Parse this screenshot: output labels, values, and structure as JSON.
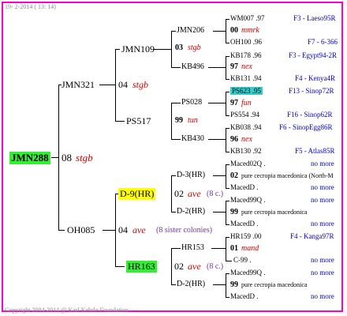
{
  "header": {
    "date": "19-  2-2014 ( 13: 14)"
  },
  "footer": {
    "copyright": "Copyright 2004-2014 @ Karl Kehrle Foundation ."
  },
  "root": {
    "name": "JMN288",
    "gen": "08",
    "breed": "stgb"
  },
  "g1": {
    "top": {
      "name": "JMN321"
    },
    "bot": {
      "name": "OH085",
      "gen": "04",
      "breed": "ave",
      "note": "(8 sister colonies)"
    }
  },
  "g2": {
    "a": {
      "name": "JMN109"
    },
    "mid": {
      "gen": "04",
      "breed": "stgb"
    },
    "b": {
      "name": "PS517"
    },
    "c": {
      "name": "D-9(HR)",
      "gen": "02",
      "breed": "ave",
      "note": "(8 c.)"
    },
    "d": {
      "name": "HR163",
      "gen": "02",
      "breed": "ave",
      "note": "(8 c.)"
    }
  },
  "g3": {
    "a": {
      "name": "JMN206",
      "gen": "03",
      "breed": "stgb"
    },
    "b": {
      "name": "KB496"
    },
    "c": {
      "name": "PS028",
      "gen": "99",
      "breed": "tun"
    },
    "d": {
      "name": "KB430"
    },
    "e": {
      "name": "D-3(HR)"
    },
    "f": {
      "name": "D-2(HR)"
    },
    "g": {
      "name": "HR153"
    },
    "h": {
      "name": "D-2(HR)"
    }
  },
  "g4": [
    {
      "name": "WM007 .97",
      "loc": "F3 - Laeso95R"
    },
    {
      "name": "00",
      "breed": "mmrk"
    },
    {
      "name": "OH100 .96",
      "loc": "F7 - 6-366"
    },
    {
      "name": "KB178 .96",
      "loc": "F3 - Egypt94-2R"
    },
    {
      "name": "97",
      "breed": "nex"
    },
    {
      "name": "KB131 .94",
      "loc": "F4 - Kenya4R"
    },
    {
      "name": "PS623 .95",
      "loc": "F13 - Sinop72R"
    },
    {
      "name": "97",
      "breed": "fun"
    },
    {
      "name": "PS554 .94",
      "loc": "F16 - Sinop62R"
    },
    {
      "name": "KB038 .94",
      "loc": "F6 - SinopEgg86R"
    },
    {
      "name": "96",
      "breed": "nex"
    },
    {
      "name": "KB130 .92",
      "loc": "F5 - Atlas85R"
    },
    {
      "name": "Maced02Q .",
      "loc": "no more"
    },
    {
      "name": "02",
      "breed": "pure cecropia macedonica (North-M"
    },
    {
      "name": "MacedD .",
      "loc": "no more"
    },
    {
      "name": "Maced99Q .",
      "loc": "no more"
    },
    {
      "name": "99",
      "breed": "pure cecropia macedonica"
    },
    {
      "name": "MacedD .",
      "loc": "no more"
    },
    {
      "name": "HR159 .00",
      "loc": "F4 - Kanga97R"
    },
    {
      "name": "01",
      "breed": "mand"
    },
    {
      "name": "C-99 .",
      "loc": "no more"
    },
    {
      "name": "Maced99Q .",
      "loc": "no more"
    },
    {
      "name": "99",
      "breed": "pure cecropia macedonica"
    },
    {
      "name": "MacedD .",
      "loc": "no more"
    }
  ]
}
